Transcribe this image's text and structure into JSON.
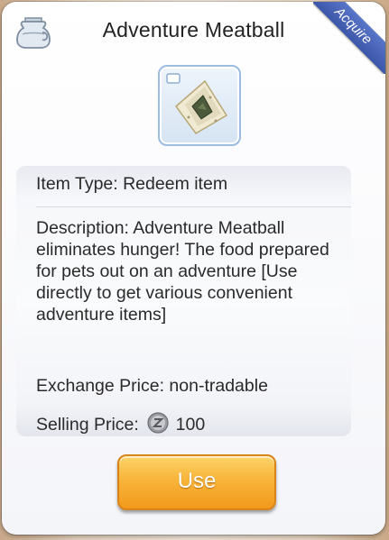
{
  "dialog": {
    "title": "Adventure Meatball",
    "ribbon_label": "Acquire",
    "jar_icon": "jar-icon",
    "item_icon": "meatball-icon"
  },
  "info": {
    "item_type": "Item Type: Redeem item",
    "description": "Description: Adventure Meatball eliminates hunger!  The food prepared for pets out on an adventure  [Use directly to get various convenient adventure items]",
    "exchange_price": "Exchange Price: non-tradable",
    "selling_price_label": "Selling Price:",
    "selling_price_value": "100",
    "currency_icon": "zeny-coin-icon"
  },
  "actions": {
    "use_label": "Use"
  },
  "colors": {
    "ribbon": "#3c56a8",
    "button": "#f8b43a",
    "text": "#2a2a2a"
  }
}
